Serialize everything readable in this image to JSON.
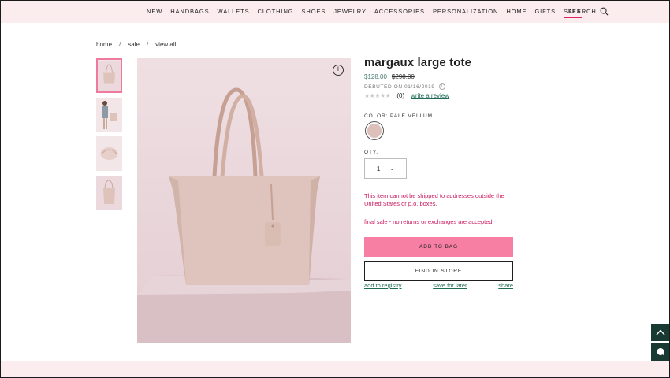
{
  "nav": {
    "items": [
      "NEW",
      "HANDBAGS",
      "WALLETS",
      "CLOTHING",
      "SHOES",
      "JEWELRY",
      "ACCESSORIES",
      "PERSONALIZATION",
      "HOME",
      "GIFTS",
      "SALE"
    ],
    "active": "SALE",
    "search_label": "SEARCH"
  },
  "breadcrumb": {
    "items": [
      "home",
      "sale",
      "view all"
    ],
    "separator": "/"
  },
  "product": {
    "title": "margaux large tote",
    "price_sale": "$128.00",
    "price_original": "$298.00",
    "debuted": "DEBUTED ON 01/16/2019",
    "review_count": "(0)",
    "review_link": "write a review",
    "color_label": "COLOR: PALE VELLUM",
    "color_hex": "#dcc0b9",
    "qty_label": "QTY.",
    "qty_value": "1",
    "shipping_notice": "This item cannot be shipped to addresses outside the United States or p.o. boxes.",
    "final_sale_notice": "final sale - no returns or exchanges are accepted",
    "add_to_bag": "ADD TO BAG",
    "find_in_store": "FIND IN STORE",
    "add_to_registry": "add to registry",
    "save_for_later": "save for later",
    "share": "share"
  },
  "colors": {
    "nav_bg": "#fbecee",
    "accent_pink": "#f67fa3",
    "alert_red": "#c8185d",
    "link_green": "#1f6b55",
    "widget_dark": "#183a33"
  }
}
